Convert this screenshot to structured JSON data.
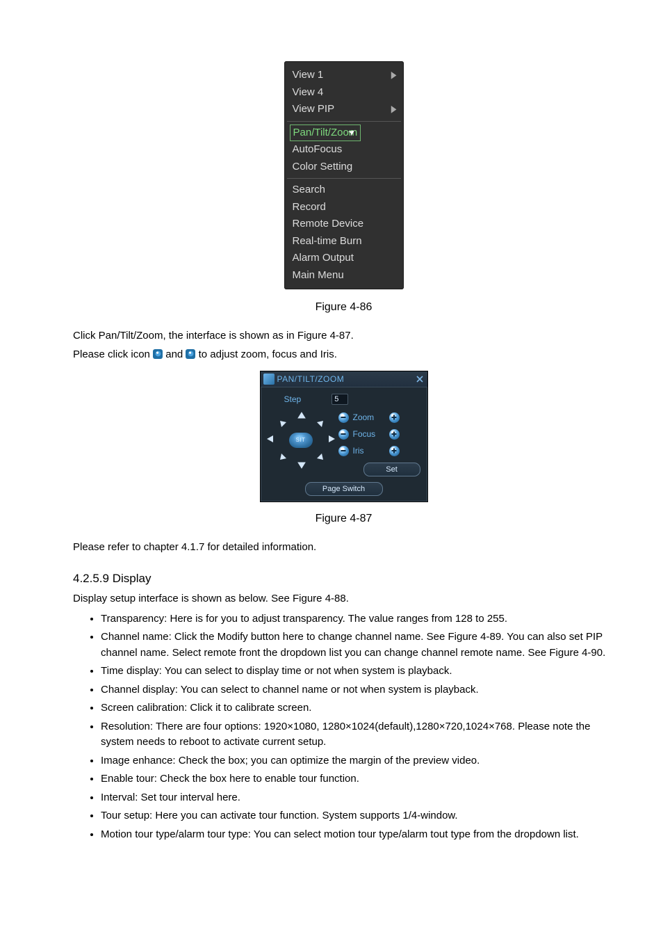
{
  "context_menu": {
    "groups": [
      {
        "items": [
          {
            "label": "View 1",
            "submenu": true
          },
          {
            "label": "View 4",
            "submenu": false
          },
          {
            "label": "View PIP",
            "submenu": true
          }
        ]
      },
      {
        "items": [
          {
            "label": "Pan/Tilt/Zoom",
            "submenu": false,
            "highlighted": true
          },
          {
            "label": "AutoFocus",
            "submenu": false
          },
          {
            "label": "Color Setting",
            "submenu": false
          }
        ]
      },
      {
        "items": [
          {
            "label": "Search",
            "submenu": false
          },
          {
            "label": "Record",
            "submenu": false
          },
          {
            "label": "Remote Device",
            "submenu": false
          },
          {
            "label": "Real-time Burn",
            "submenu": false
          },
          {
            "label": "Alarm Output",
            "submenu": false
          },
          {
            "label": "Main Menu",
            "submenu": false
          }
        ]
      }
    ]
  },
  "figure86_caption": "Figure 4-86",
  "para1": "Click Pan/Tilt/Zoom, the interface is shown as in Figure 4-87.",
  "para2_pre": "Please click icon ",
  "para2_mid": " and ",
  "para2_post": " to adjust zoom, focus and Iris.",
  "ptz": {
    "title": "PAN/TILT/ZOOM",
    "step_label": "Step",
    "step_value": "5",
    "center_label": "SIT",
    "rows": [
      {
        "label": "Zoom"
      },
      {
        "label": "Focus"
      },
      {
        "label": "Iris"
      }
    ],
    "set_label": "Set",
    "page_switch_label": "Page Switch"
  },
  "figure87_caption": "Figure 4-87",
  "para3": "Please refer to chapter 4.1.7 for detailed information.",
  "display_section": {
    "heading": "4.2.5.9  Display",
    "intro": "Display setup interface is shown as below. See Figure 4-88.",
    "bullets": [
      "Transparency: Here is for you to adjust transparency. The value ranges from 128 to 255.",
      "Channel name: Click the Modify button here to change channel name. See Figure 4-89. You can also set PIP channel name. Select remote front the dropdown list you can change channel remote name. See Figure 4-90.",
      "Time display: You can select to display time or not when system is playback.",
      "Channel display: You can select to channel name or not when system is playback.",
      "Screen calibration: Click it to calibrate screen.",
      "Resolution: There are four options: 1920×1080, 1280×1024(default),1280×720,1024×768. Please note the system needs to reboot to activate current setup.",
      "Image enhance: Check the box; you can optimize the margin of the preview video.",
      "Enable tour: Check the box here to enable tour function.",
      "Interval: Set tour interval here.",
      "Tour setup: Here you can activate tour function.  System supports 1/4-window.",
      "Motion tour type/alarm tour type: You can select motion tour type/alarm tout type from the dropdown list."
    ]
  }
}
